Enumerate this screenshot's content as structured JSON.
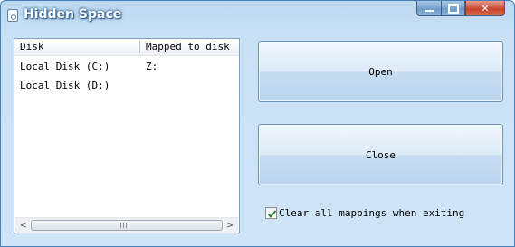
{
  "window": {
    "title": "Hidden Space",
    "icon": "app-disk-icon"
  },
  "title_buttons": {
    "minimize_icon": "minimize-icon",
    "maximize_icon": "maximize-icon",
    "close_glyph": "✕"
  },
  "disk_list": {
    "columns": [
      "Disk",
      "Mapped to disk"
    ],
    "rows": [
      {
        "disk": "Local Disk (C:)",
        "mapped": "Z:"
      },
      {
        "disk": "Local Disk (D:)",
        "mapped": ""
      }
    ],
    "scroll_left": "<",
    "scroll_right": ">"
  },
  "actions": {
    "open_label": "Open",
    "close_label": "Close"
  },
  "options": {
    "clear_mappings_label": "Clear all mappings when exiting",
    "clear_mappings_checked": true
  },
  "colors": {
    "window_bg": "#cfe4f6",
    "accent_green_check": "#2e7d32"
  }
}
